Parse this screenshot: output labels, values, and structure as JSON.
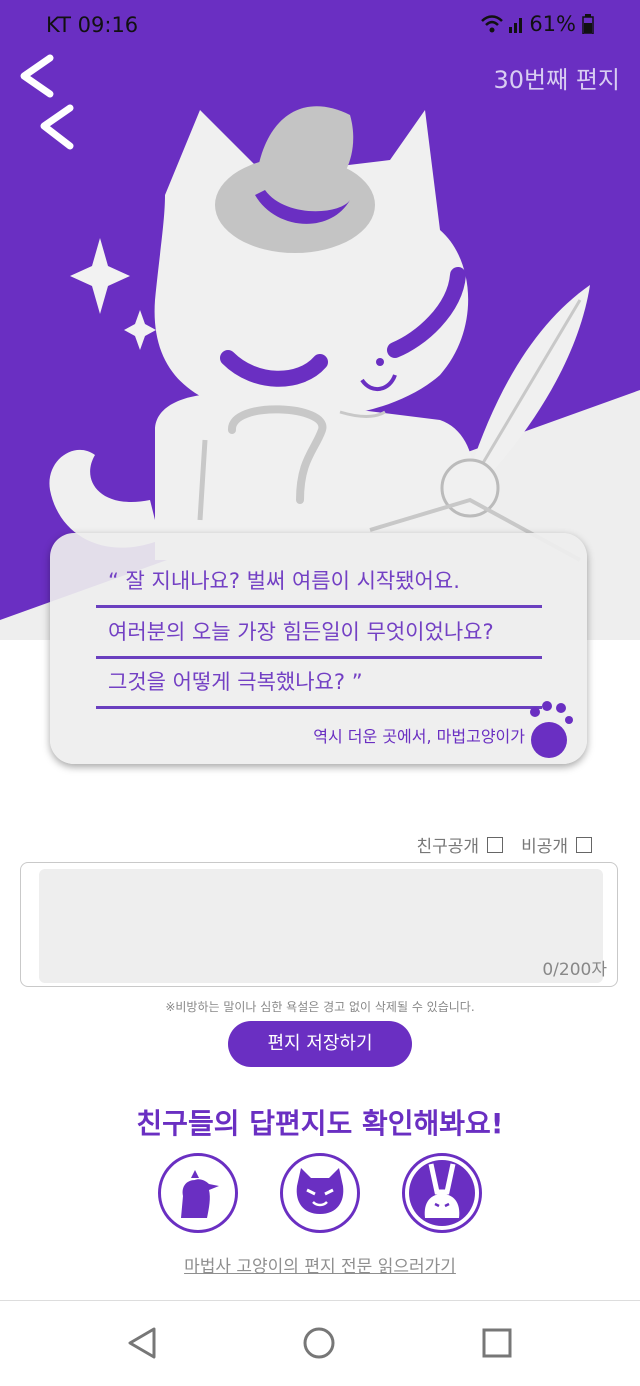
{
  "status_bar": {
    "carrier_time": "KT  09:16",
    "battery": "61%",
    "icons": [
      "wifi-icon",
      "signal-icon",
      "battery-icon"
    ]
  },
  "header": {
    "back_icon": "back-chevron-icon",
    "letter_number": "30번째 편지"
  },
  "colors": {
    "accent": "#6a2fc2",
    "hero_bg": "#6a2fc2",
    "hero_light": "#eeeeee"
  },
  "letter": {
    "lines": [
      "“ 잘 지내나요?  벌써 여름이 시작됐어요.",
      "여러분의 오늘 가장 힘든일이 무엇이었나요?",
      "그것을 어떻게 극복했나요? ”"
    ],
    "signature": "역시 더운 곳에서, 마법고양이가",
    "paw_icon": "paw-icon"
  },
  "reply": {
    "options": [
      {
        "label": "친구공개",
        "checked": false
      },
      {
        "label": "비공개",
        "checked": false
      }
    ],
    "value": "",
    "counter": "0/200자",
    "warning": "※비방하는 말이나 심한 욕설은 경고 없이 삭제될 수 있습니다.",
    "save_label": "편지 저장하기"
  },
  "friends": {
    "title": "친구들의 답편지도 확인해봐요!",
    "avatars": [
      "bird-avatar-icon",
      "cat-avatar-icon",
      "rabbit-avatar-icon"
    ]
  },
  "read_full_link": "마법사 고양이의 편지 전문 읽으러가기",
  "nav": [
    "back-triangle-icon",
    "home-circle-icon",
    "recents-square-icon"
  ]
}
